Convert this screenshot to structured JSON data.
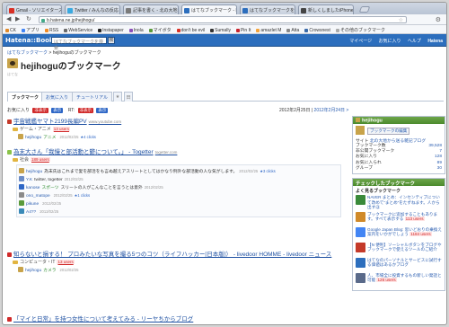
{
  "browser": {
    "tabs": [
      {
        "label": "Gmail - ソリエイターズがい",
        "color": "#d93025"
      },
      {
        "label": "Twitter / みんなの反応",
        "color": "#39a9e0"
      },
      {
        "label": "記事を書く - 北の大地から",
        "color": "#7a7a7a"
      },
      {
        "label": "はてなブックマーク - hej",
        "color": "#2c6ebd"
      },
      {
        "label": "はてなブックマークを便利",
        "color": "#2c6ebd"
      },
      {
        "label": "新しくしましたiPhone 8用",
        "color": "#444"
      }
    ],
    "url": "b.hatena.ne.jp/hejihogu/",
    "bookmarks": [
      {
        "label": "CK",
        "color": "#e08a2a"
      },
      {
        "label": "アプリ",
        "color": "#4285f4"
      },
      {
        "label": "RSS",
        "color": "#f08a24"
      },
      {
        "label": "WebService",
        "color": "#6a6a6a"
      },
      {
        "label": "Instapaper",
        "color": "#222"
      },
      {
        "label": "Inola",
        "color": "#8a4fb8"
      },
      {
        "label": "マイボタ",
        "color": "#5a9a3a"
      },
      {
        "label": "don't be evil",
        "color": "#d93025"
      },
      {
        "label": "Sumally",
        "color": "#333"
      },
      {
        "label": "Pin It",
        "color": "#c8232c"
      },
      {
        "label": "amazlet M",
        "color": "#f3a33b"
      },
      {
        "label": "Atta",
        "color": "#888"
      },
      {
        "label": "Crowsnest",
        "color": "#3a6aa8"
      },
      {
        "label": "その他のブックマーク",
        "color": "#aaa"
      }
    ]
  },
  "hatena_header": {
    "logo": "Hatena::Bookmark",
    "search_placeholder": "はてなブックマークを検索",
    "go": "検",
    "links": [
      "マイページ",
      "お気に入り",
      "ヘルプ"
    ],
    "right_logo": "Hatena"
  },
  "breadcrumb": {
    "home": "はてなブックマーク",
    "sep": " > ",
    "current": "hejihoguのブックマーク"
  },
  "page_title": "hejihoguのブックマーク",
  "page_note": "はてな",
  "page_tabs": [
    "ブックマーク",
    "お気に入り",
    "チュートリアル",
    "★",
    "田"
  ],
  "filter": {
    "label": "お気に入り",
    "chips": [
      "非表示",
      "表示",
      "非表示",
      "表示"
    ],
    "rt": "RT:",
    "note": "表示 非表示"
  },
  "date": {
    "current": "2012年2月25日 |",
    "link": "2012年2月24日 >"
  },
  "entries": [
    {
      "title": "宇宙戦艦ヤマト2199長編PV",
      "source": "www.youtube.com",
      "category": "ゲーム・アニメ",
      "users": "13 users",
      "fav_color": "#c43a2a",
      "comments": [
        {
          "user": "hejihogu",
          "tag": "アニメ",
          "text": "",
          "date": "2012/02/25",
          "stars": "★4 clicks",
          "color": "#c8a34a"
        }
      ]
    },
    {
      "title": "為末大さん「我慢と部活動と鬱について。」 - Togetter",
      "source": "togetter.com",
      "category": "社会",
      "users": "189 users",
      "fav_color": "#8bc34a",
      "comments": [
        {
          "user": "hejihogu",
          "tag": "",
          "text": "為末氏はこれまで愛を部活をも言ぬ越えアスリートとしてはかなり例外な部活動の人な気がします。",
          "date": "2012/02/25",
          "stars": "★3 clicks",
          "color": "#c8a34a"
        },
        {
          "user": "Y.K",
          "tag": "",
          "text": "twitter, togetter",
          "date": "2012/02/25",
          "stars": "",
          "color": "#6b8cc7"
        },
        {
          "user": "kanose",
          "tag": "スポーツ",
          "text": "スリートの人がこんなことを言うとは意外",
          "date": "2012/02/25",
          "stars": "",
          "color": "#2d66c6"
        },
        {
          "user": "ono_matope",
          "tag": "",
          "text": "",
          "date": "2012/02/25",
          "stars": "★1 clicks",
          "color": "#8a8a8a"
        },
        {
          "user": "pikune",
          "tag": "",
          "text": "",
          "date": "2012/02/25",
          "stars": "",
          "color": "#5a9a3a"
        },
        {
          "user": "A4??",
          "tag": "",
          "text": "",
          "date": "2012/02/25",
          "stars": "",
          "color": "#3a8ab8"
        }
      ]
    },
    {
      "title": "知らないと損する！ プロみたいな写真を撮る5つのコツ（ライフハッカー[日本版]） - livedoor HOMME - livedoor ニュース",
      "source": "",
      "category": "コンピュータ・IT",
      "users": "13 users",
      "fav_color": "#d02a2a",
      "comments": [
        {
          "user": "hejihogu",
          "tag": "カメラ",
          "text": "",
          "date": "2012/02/25",
          "stars": "",
          "color": "#c8a34a"
        }
      ]
    },
    {
      "title": "「マイと日常」を持つ女性について考えてみる - リーヤちからブログ",
      "source": "",
      "category": "",
      "users": "",
      "fav_color": "#d02a2a",
      "comments": []
    }
  ],
  "sidebar": {
    "profile": {
      "name": "hejihogu",
      "edit": "ブックマークの編集",
      "site_label": "サイト",
      "site": "北の大地から送る雑記ブログ",
      "stats": [
        {
          "k": "ブックマーク数",
          "v": "39,528"
        },
        {
          "k": "非公開ブックマーク",
          "v": "7"
        },
        {
          "k": "お気に入り",
          "v": "128"
        },
        {
          "k": "お気に入られ",
          "v": "89"
        },
        {
          "k": "グループ",
          "v": "30"
        }
      ]
    },
    "checked": {
      "title": "チェックしたブックマーク",
      "subtitle": "よく見るブックマーク",
      "items": [
        {
          "text": "NAVER まとめ：インセンティブについて改めて“まとめ”をたずねます。人から出すほ",
          "users": "",
          "color": "#3a8a3a"
        },
        {
          "text": "ブックマークに追加することもあります。すべて表示する",
          "users": "113 users",
          "color": "#d08a2a"
        },
        {
          "text": "Google Japan Blog: 思いどおりの乗換え案内をいかがでしょう",
          "users": "1184 users",
          "color": "#4285f4"
        },
        {
          "text": "【N 便利】ソーシャルボタンをブログやブックマークで使えるツールのご紹介",
          "users": "",
          "color": "#c43a2a"
        },
        {
          "text": "はてなのパーソナルとサービスに試行する価値はあるかプログ",
          "users": "",
          "color": "#2c6ebd"
        },
        {
          "text": "人、市場全に投資するもの新しい発話と可能",
          "users": "126 users",
          "color": "#5a6a8a"
        }
      ]
    }
  }
}
